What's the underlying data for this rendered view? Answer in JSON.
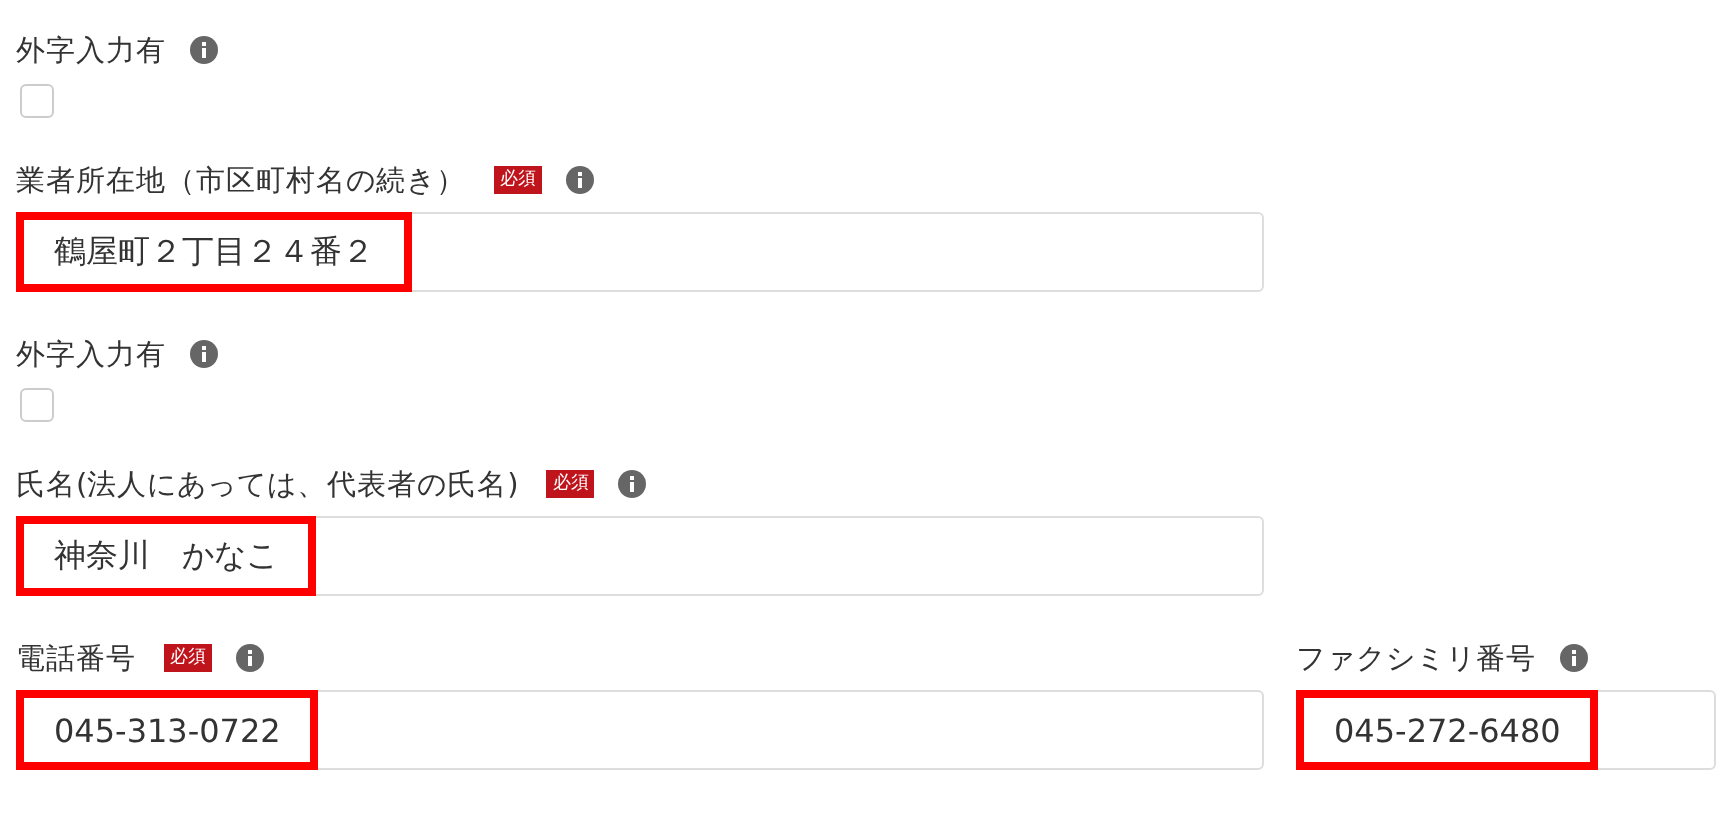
{
  "rows": [
    {
      "fields": [
        {
          "kind": "checkbox",
          "label": "外字入力有",
          "required": false,
          "info": true,
          "checked": false
        }
      ]
    },
    {
      "fields": [
        {
          "kind": "text",
          "label": "業者所在地（市区町村名の続き）",
          "required": true,
          "required_label": "必須",
          "info": true,
          "value": "鶴屋町２丁目２４番２",
          "highlighted": true
        }
      ]
    },
    {
      "fields": [
        {
          "kind": "checkbox",
          "label": "外字入力有",
          "required": false,
          "info": true,
          "checked": false
        }
      ]
    },
    {
      "fields": [
        {
          "kind": "text",
          "label": "氏名(法人にあっては、代表者の氏名)",
          "required": true,
          "required_label": "必須",
          "info": true,
          "value": "神奈川　かなこ",
          "highlighted": true
        }
      ]
    },
    {
      "fields": [
        {
          "kind": "text",
          "label": "電話番号",
          "required": true,
          "required_label": "必須",
          "info": true,
          "value": "045-313-0722",
          "highlighted": true
        },
        {
          "kind": "text",
          "label": "ファクシミリ番号",
          "required": false,
          "info": true,
          "value": "045-272-6480",
          "highlighted": true
        }
      ]
    }
  ]
}
